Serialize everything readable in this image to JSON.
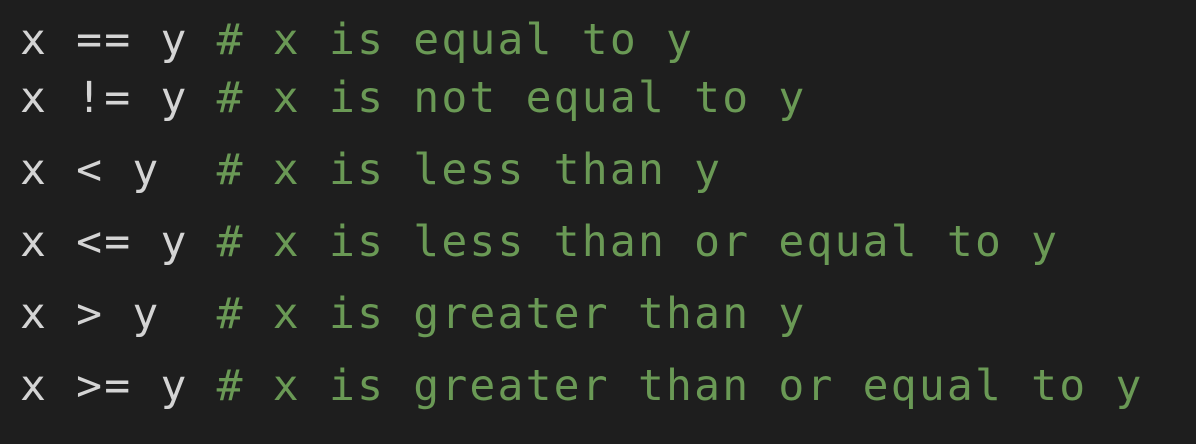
{
  "editor": {
    "colors": {
      "background": "#1e1e1e",
      "code": "#d4d4d4",
      "comment": "#6a9955"
    },
    "lines": [
      {
        "code": "x == y ",
        "comment": "# x is equal to y"
      },
      {
        "code": "x != y ",
        "comment": "# x is not equal to y"
      },
      {
        "code": "x < y  ",
        "comment": "# x is less than y"
      },
      {
        "code": "x <= y ",
        "comment": "# x is less than or equal to y"
      },
      {
        "code": "x > y  ",
        "comment": "# x is greater than y"
      },
      {
        "code": "x >= y ",
        "comment": "# x is greater than or equal to y"
      }
    ]
  }
}
